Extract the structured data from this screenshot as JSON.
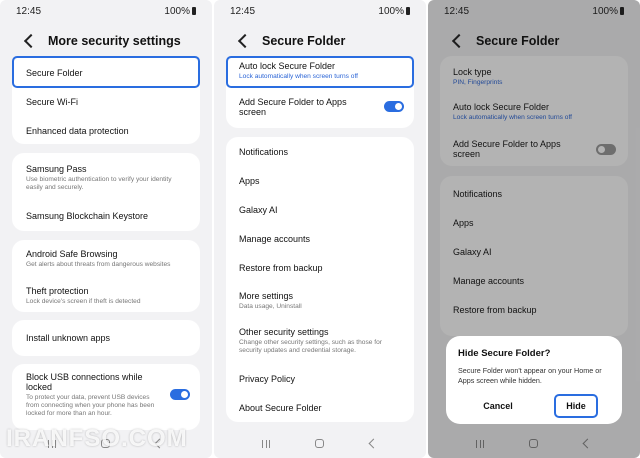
{
  "status": {
    "time": "12:45",
    "battery": "100%"
  },
  "screen1": {
    "title": "More security settings",
    "items": [
      {
        "title": "Secure Folder"
      },
      {
        "title": "Secure Wi-Fi"
      },
      {
        "title": "Enhanced data protection"
      },
      {
        "title": "Samsung Pass",
        "subtitle": "Use biometric authentication to verify your identity easily and securely."
      },
      {
        "title": "Samsung Blockchain Keystore"
      },
      {
        "title": "Android Safe Browsing",
        "subtitle": "Get alerts about threats from dangerous websites"
      },
      {
        "title": "Theft protection",
        "subtitle": "Lock device's screen if theft is detected"
      },
      {
        "title": "Install unknown apps"
      },
      {
        "title": "Block USB connections while locked",
        "subtitle": "To protect your data, prevent USB devices from connecting when your phone has been locked for more than an hour."
      }
    ]
  },
  "screen2": {
    "title": "Secure Folder",
    "items": [
      {
        "title": "Auto lock Secure Folder",
        "subtitle": "Lock automatically when screen turns off"
      },
      {
        "title": "Add Secure Folder to Apps screen"
      },
      {
        "title": "Notifications"
      },
      {
        "title": "Apps"
      },
      {
        "title": "Galaxy AI"
      },
      {
        "title": "Manage accounts"
      },
      {
        "title": "Restore from backup"
      },
      {
        "title": "More settings",
        "subtitle": "Data usage, Uninstall"
      },
      {
        "title": "Other security settings",
        "subtitle": "Change other security settings, such as those for security updates and credential storage."
      },
      {
        "title": "Privacy Policy"
      },
      {
        "title": "About Secure Folder"
      }
    ]
  },
  "screen3": {
    "title": "Secure Folder",
    "items": [
      {
        "title": "Lock type",
        "subtitle": "PIN, Fingerprints"
      },
      {
        "title": "Auto lock Secure Folder",
        "subtitle": "Lock automatically when screen turns off"
      },
      {
        "title": "Add Secure Folder to Apps screen"
      },
      {
        "title": "Notifications"
      },
      {
        "title": "Apps"
      },
      {
        "title": "Galaxy AI"
      },
      {
        "title": "Manage accounts"
      },
      {
        "title": "Restore from backup"
      }
    ],
    "dialog": {
      "title": "Hide Secure Folder?",
      "message": "Secure Folder won't appear on your Home or Apps screen while hidden.",
      "cancel": "Cancel",
      "confirm": "Hide"
    }
  },
  "watermark": "IRANFSO.COM",
  "colors": {
    "accent": "#2a6de0",
    "background": "#f2f2f4",
    "card": "#ffffff"
  },
  "icons": [
    "back-arrow-icon",
    "recent-apps-icon",
    "home-icon",
    "nav-back-icon",
    "battery-icon"
  ]
}
